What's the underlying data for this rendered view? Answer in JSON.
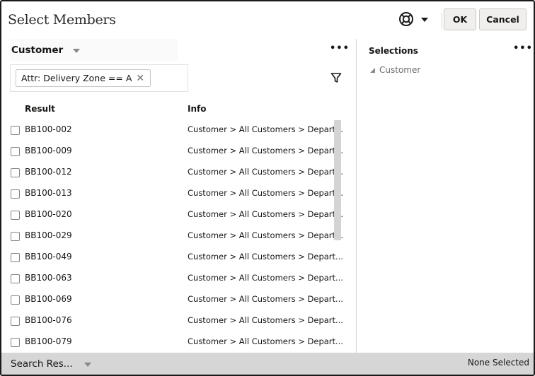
{
  "dialog": {
    "title": "Select Members",
    "ok_label": "OK",
    "cancel_label": "Cancel",
    "help_icon": "lifebuoy-icon"
  },
  "left_panel": {
    "dimension_label": "Customer",
    "filter_chip": "Attr: Delivery Zone == A",
    "columns": {
      "result": "Result",
      "info": "Info"
    },
    "rows": [
      {
        "result": "BB100-002",
        "info": "Customer > All Customers > Depart...",
        "checked": false
      },
      {
        "result": "BB100-009",
        "info": "Customer > All Customers > Depart...",
        "checked": false
      },
      {
        "result": "BB100-012",
        "info": "Customer > All Customers > Depart...",
        "checked": false
      },
      {
        "result": "BB100-013",
        "info": "Customer > All Customers > Depart...",
        "checked": false
      },
      {
        "result": "BB100-020",
        "info": "Customer > All Customers > Depart...",
        "checked": false
      },
      {
        "result": "BB100-029",
        "info": "Customer > All Customers > Depart...",
        "checked": false
      },
      {
        "result": "BB100-049",
        "info": "Customer > All Customers > Depart...",
        "checked": false
      },
      {
        "result": "BB100-063",
        "info": "Customer > All Customers > Depart...",
        "checked": false
      },
      {
        "result": "BB100-069",
        "info": "Customer > All Customers > Depart...",
        "checked": false
      },
      {
        "result": "BB100-076",
        "info": "Customer > All Customers > Depart...",
        "checked": false
      },
      {
        "result": "BB100-079",
        "info": "Customer > All Customers > Depart...",
        "checked": false
      }
    ]
  },
  "right_panel": {
    "title": "Selections",
    "tree_root": "Customer"
  },
  "footer": {
    "search_mode": "Search Res...",
    "status": "None Selected"
  }
}
